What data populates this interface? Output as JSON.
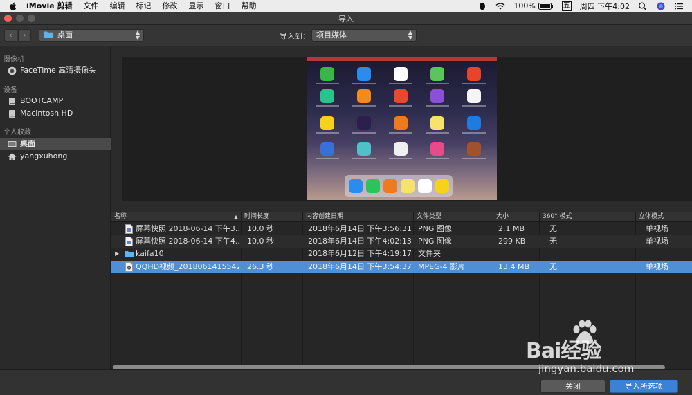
{
  "menubar": {
    "app_name": "iMovie 剪辑",
    "items": [
      "文件",
      "编辑",
      "标记",
      "修改",
      "显示",
      "窗口",
      "帮助"
    ],
    "battery": "100%",
    "input_method": "五",
    "clock": "周四 下午4:02"
  },
  "window": {
    "title": "导入"
  },
  "toolbar": {
    "location": "桌面",
    "import_to_label": "导入到：",
    "import_to_value": "项目媒体"
  },
  "sidebar": {
    "sections": [
      {
        "heading": "摄像机",
        "items": [
          {
            "label": "FaceTime 高清摄像头",
            "icon": "camera-icon"
          }
        ]
      },
      {
        "heading": "设备",
        "items": [
          {
            "label": "BOOTCAMP",
            "icon": "disk-icon"
          },
          {
            "label": "Macintosh HD",
            "icon": "disk-icon"
          }
        ]
      },
      {
        "heading": "个人收藏",
        "items": [
          {
            "label": "桌面",
            "icon": "desktop-icon",
            "selected": true
          },
          {
            "label": "yangxuhong",
            "icon": "home-icon"
          }
        ]
      }
    ]
  },
  "table": {
    "columns": [
      "名称",
      "时间长度",
      "内容创建日期",
      "文件类型",
      "大小",
      "360° 模式",
      "立体模式"
    ],
    "rows": [
      {
        "name": "屏幕快照 2018-06-14 下午3....",
        "duration": "10.0 秒",
        "date": "2018年6月14日 下午3:56:31",
        "type": "PNG 图像",
        "size": "2.1 MB",
        "mode360": "无",
        "stereo": "单视场",
        "icon": "image-file-icon"
      },
      {
        "name": "屏幕快照 2018-06-14 下午4....",
        "duration": "10.0 秒",
        "date": "2018年6月14日 下午4:02:13",
        "type": "PNG 图像",
        "size": "299 KB",
        "mode360": "无",
        "stereo": "单视场",
        "icon": "image-file-icon"
      },
      {
        "name": "kaifa10",
        "duration": "",
        "date": "2018年6月12日 下午4:19:17",
        "type": "文件夹",
        "size": "",
        "mode360": "",
        "stereo": "",
        "icon": "folder-icon"
      },
      {
        "name": "QQHD视频_20180614155427...",
        "duration": "26.3 秒",
        "date": "2018年6月14日 下午3:54:37",
        "type": "MPEG-4 影片",
        "size": "13.4 MB",
        "mode360": "无",
        "stereo": "单视场",
        "icon": "video-file-icon",
        "selected": true
      }
    ]
  },
  "buttons": {
    "close": "关闭",
    "import_selected": "导入所选项"
  },
  "watermark": {
    "logo": "Bai经验",
    "url": "jingyan.baidu.com"
  },
  "colors": {
    "selection": "#4f8fd6",
    "primary_button": "#3b82d6"
  }
}
